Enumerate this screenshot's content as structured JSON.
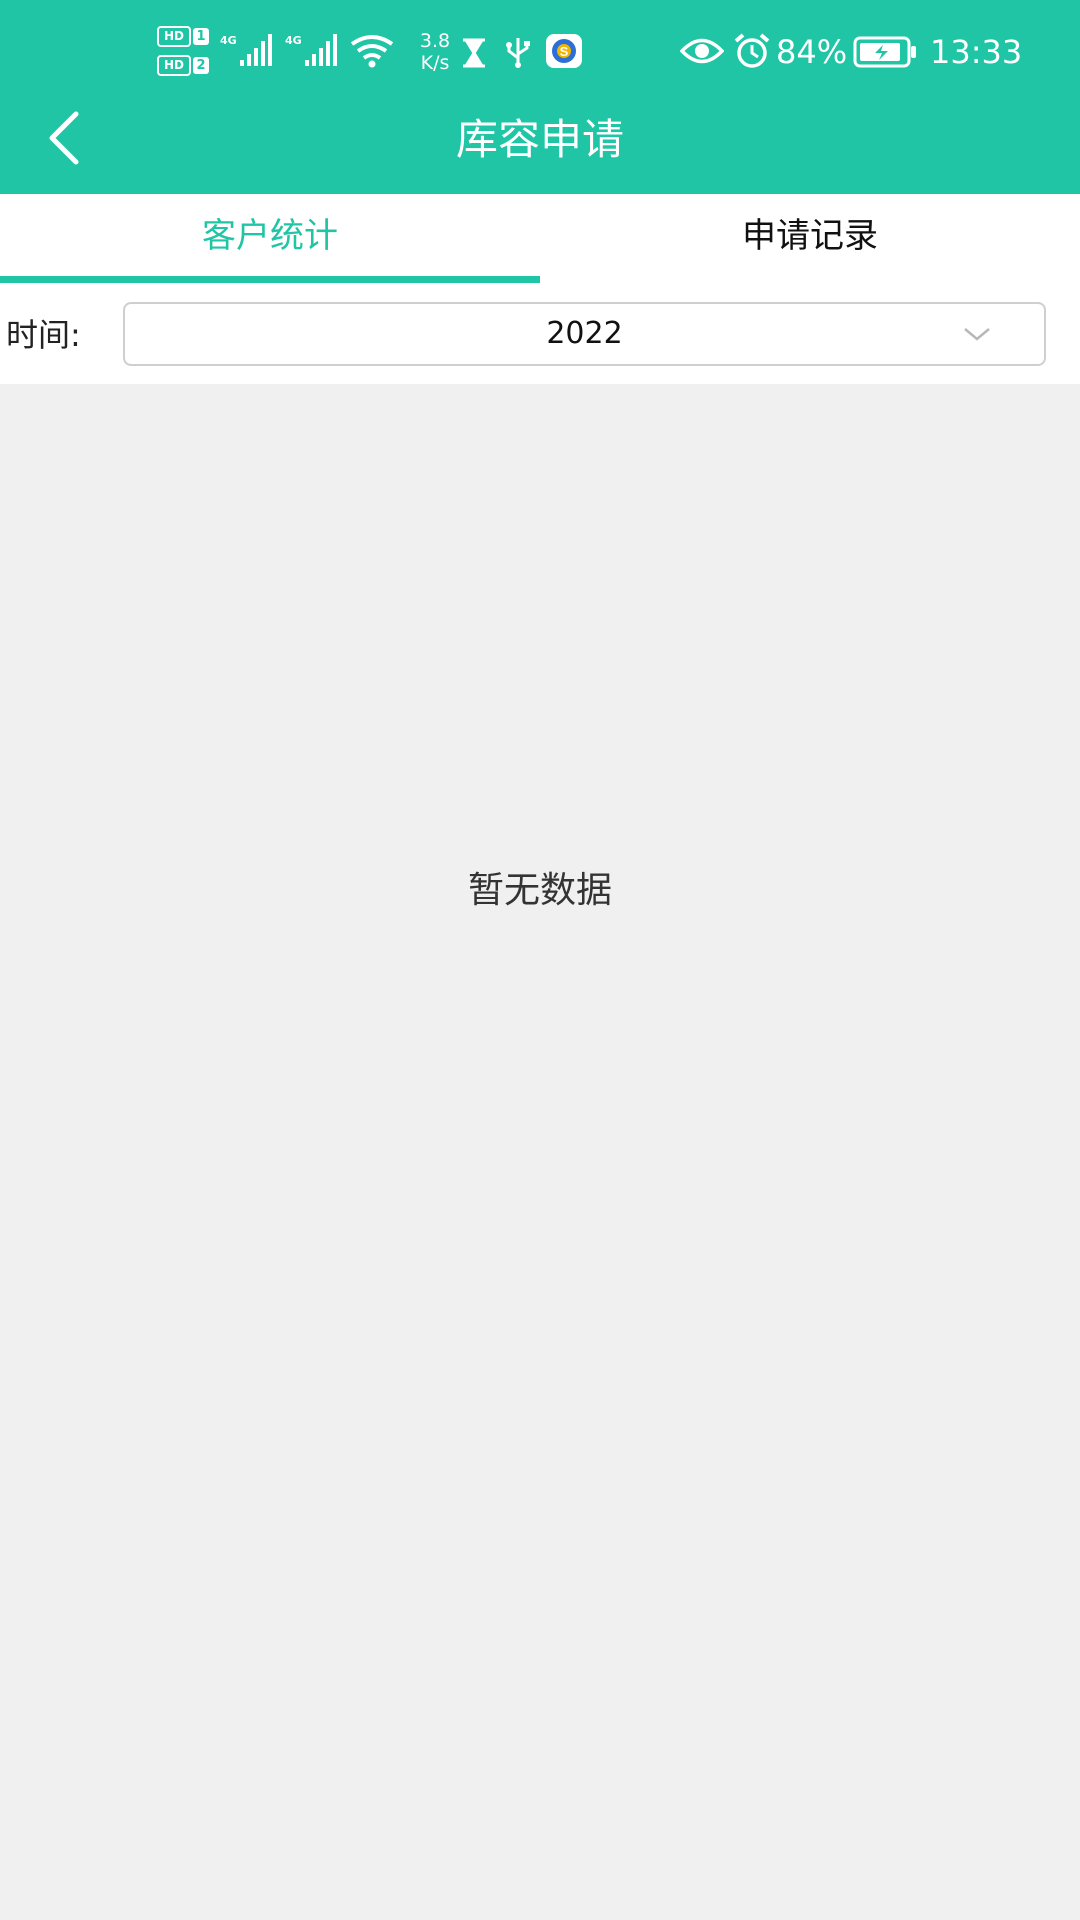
{
  "status_bar": {
    "sim1_label": "HD",
    "sim1_slot": "1",
    "sim2_label": "HD",
    "sim2_slot": "2",
    "lte1": "4G",
    "lte2": "4G",
    "net_speed_value": "3.8",
    "net_speed_unit": "K/s",
    "battery_percent": "84%",
    "time": "13:33",
    "icons": [
      "signal-icon",
      "wifi-icon",
      "hourglass-icon",
      "usb-icon",
      "app-icon",
      "eye-icon",
      "alarm-icon",
      "battery-charging-icon"
    ]
  },
  "header": {
    "title": "库容申请",
    "back_icon": "chevron-left-icon"
  },
  "tabs": [
    {
      "label": "客户统计",
      "active": true
    },
    {
      "label": "申请记录",
      "active": false
    }
  ],
  "filter": {
    "label": "时间:",
    "selected_value": "2022",
    "dropdown_icon": "chevron-down-icon"
  },
  "main": {
    "empty_text": "暂无数据"
  },
  "colors": {
    "accent": "#20c5a5",
    "background": "#f0f0f1"
  }
}
